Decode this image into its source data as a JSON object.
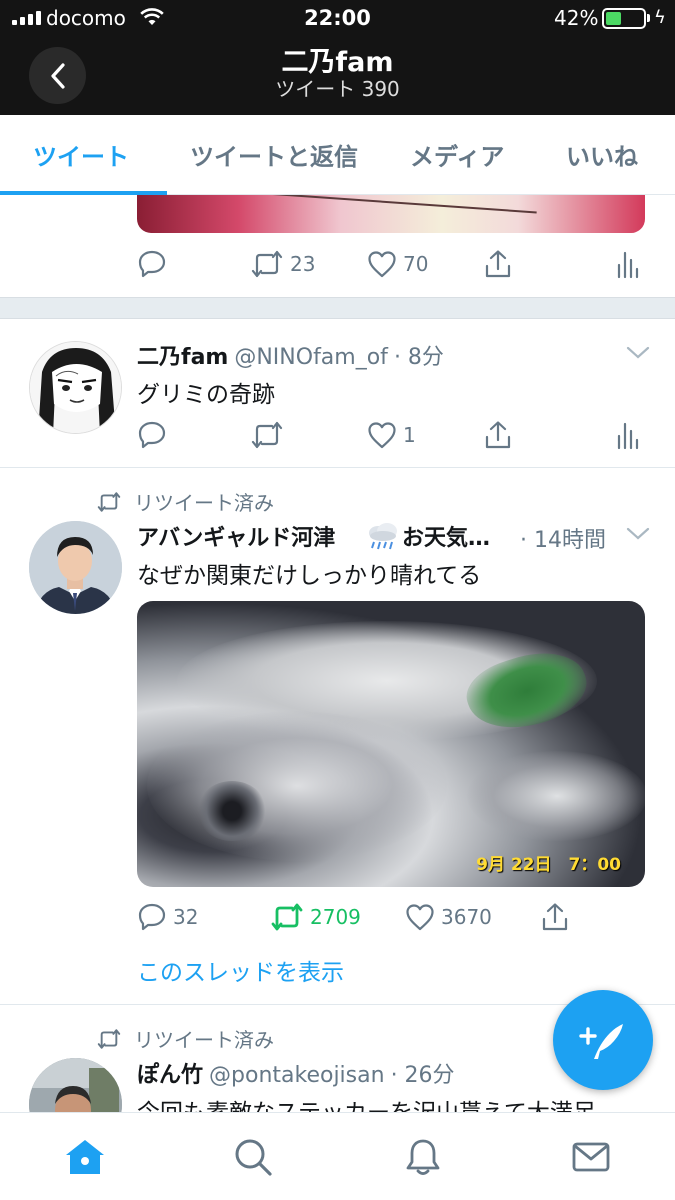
{
  "status_bar": {
    "carrier": "docomo",
    "time": "22:00",
    "battery_pct": "42%",
    "battery_level": 0.42
  },
  "header": {
    "title": "二乃fam",
    "subtitle": "ツイート 390"
  },
  "tabs": [
    {
      "label": "ツイート",
      "active": true
    },
    {
      "label": "ツイートと返信",
      "active": false
    },
    {
      "label": "メディア",
      "active": false
    },
    {
      "label": "いいね",
      "active": false
    }
  ],
  "tweets": [
    {
      "partial": true,
      "actions": {
        "reply": "",
        "retweet": "23",
        "like": "70"
      }
    },
    {
      "name": "二乃fam",
      "handle": "@NINOfam_of",
      "time": "· 8分",
      "text": "グリミの奇跡",
      "actions": {
        "reply": "",
        "retweet": "",
        "like": "1"
      }
    },
    {
      "retweeted_label": "リツイート済み",
      "name": "アバンギャルド河津",
      "name_suffix": "お天気…",
      "time": "· 14時間",
      "text": "なぜか関東だけしっかり晴れてる",
      "media_caption": "9月 22日　7：00",
      "actions": {
        "reply": "32",
        "retweet": "2709",
        "like": "3670"
      },
      "thread_link": "このスレッドを表示"
    },
    {
      "retweeted_label": "リツイート済み",
      "name": "ぽん竹",
      "handle": "@pontakeojisan",
      "time": "· 26分",
      "text": "今回も素敵なステッカーを沢山貰えて大満足"
    }
  ],
  "colors": {
    "accent": "#1da1f2",
    "retweet_active": "#17bf63",
    "header_bg": "#141414",
    "muted": "#657786"
  },
  "icons": {
    "back": "chevron-left-icon",
    "reply": "reply-icon",
    "retweet": "retweet-icon",
    "like": "heart-icon",
    "share": "share-icon",
    "analytics": "analytics-icon",
    "compose": "compose-tweet-icon",
    "home": "home-icon",
    "search": "search-icon",
    "notifications": "bell-icon",
    "messages": "mail-icon"
  }
}
